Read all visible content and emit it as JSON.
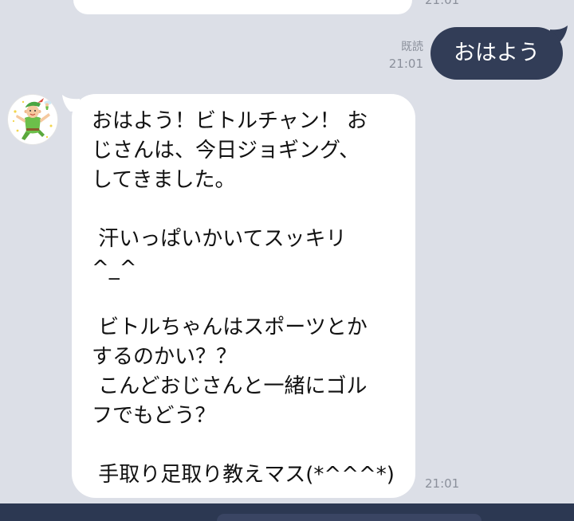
{
  "colors": {
    "chat_background": "#dcdfe7",
    "incoming_bubble": "#ffffff",
    "outgoing_bubble": "#323d57",
    "outgoing_text": "#ffffff",
    "message_text": "#111111",
    "meta_text": "#8b909b",
    "input_bar": "#2c3852",
    "input_field": "#3a4563"
  },
  "icons": {
    "sender_avatar": "cartoon-character-avatar-icon"
  },
  "chat": {
    "previous_message": {
      "time": "21:01"
    },
    "outgoing_message": {
      "text": "おはよう",
      "read_status": "既読",
      "time": "21:01"
    },
    "incoming_message": {
      "paragraphs": [
        [
          "おはよう！ビトルチャン！ お",
          "じさんは、今日ジョギング、",
          "してきました。"
        ],
        [
          " 汗いっぱいかいてスッキリ",
          "^_^"
        ],
        [
          " ビトルちゃんはスポーツとか",
          "するのかい？？",
          " こんどおじさんと一緒にゴル",
          "フでもどう？"
        ],
        [
          " 手取り足取り教えマス(*^^^*)"
        ]
      ],
      "time": "21:01"
    }
  }
}
